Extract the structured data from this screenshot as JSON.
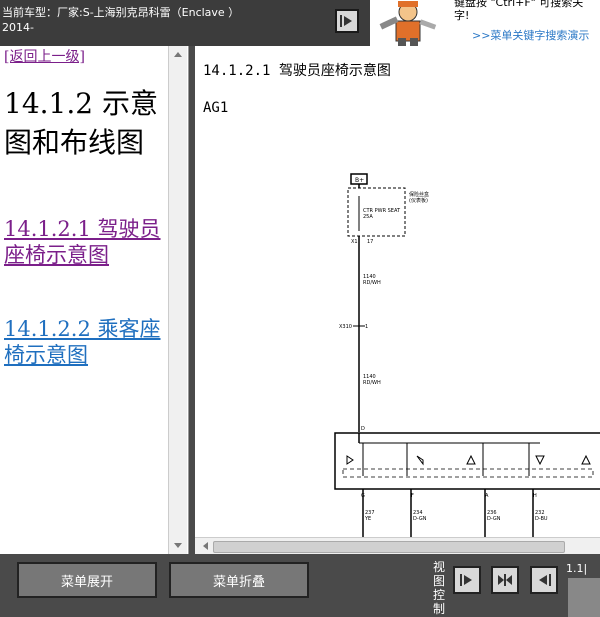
{
  "header": {
    "vehicle_line1": "当前车型：厂家:S-上海别克昂科雷（Enclave ）",
    "vehicle_line2": "2014-",
    "tip_line1": "键盘按 \"Ctrl+F\" 可搜索关",
    "tip_line2": "字!",
    "tip_link": ">>菜单关键字搜索演示"
  },
  "left": {
    "back_link": "[返回上一级]",
    "section_title": "14.1.2 示意图和布线图",
    "links": [
      "14.1.2.1 驾驶员座椅示意图",
      "14.1.2.2 乘客座椅示意图"
    ]
  },
  "doc": {
    "title": "14.1.2.1 驾驶员座椅示意图",
    "ag_label": "AG1"
  },
  "bottom": {
    "expand": "菜单展开",
    "collapse": "菜单折叠",
    "view_control": "视图控制",
    "page_indicator": "1.1|"
  }
}
